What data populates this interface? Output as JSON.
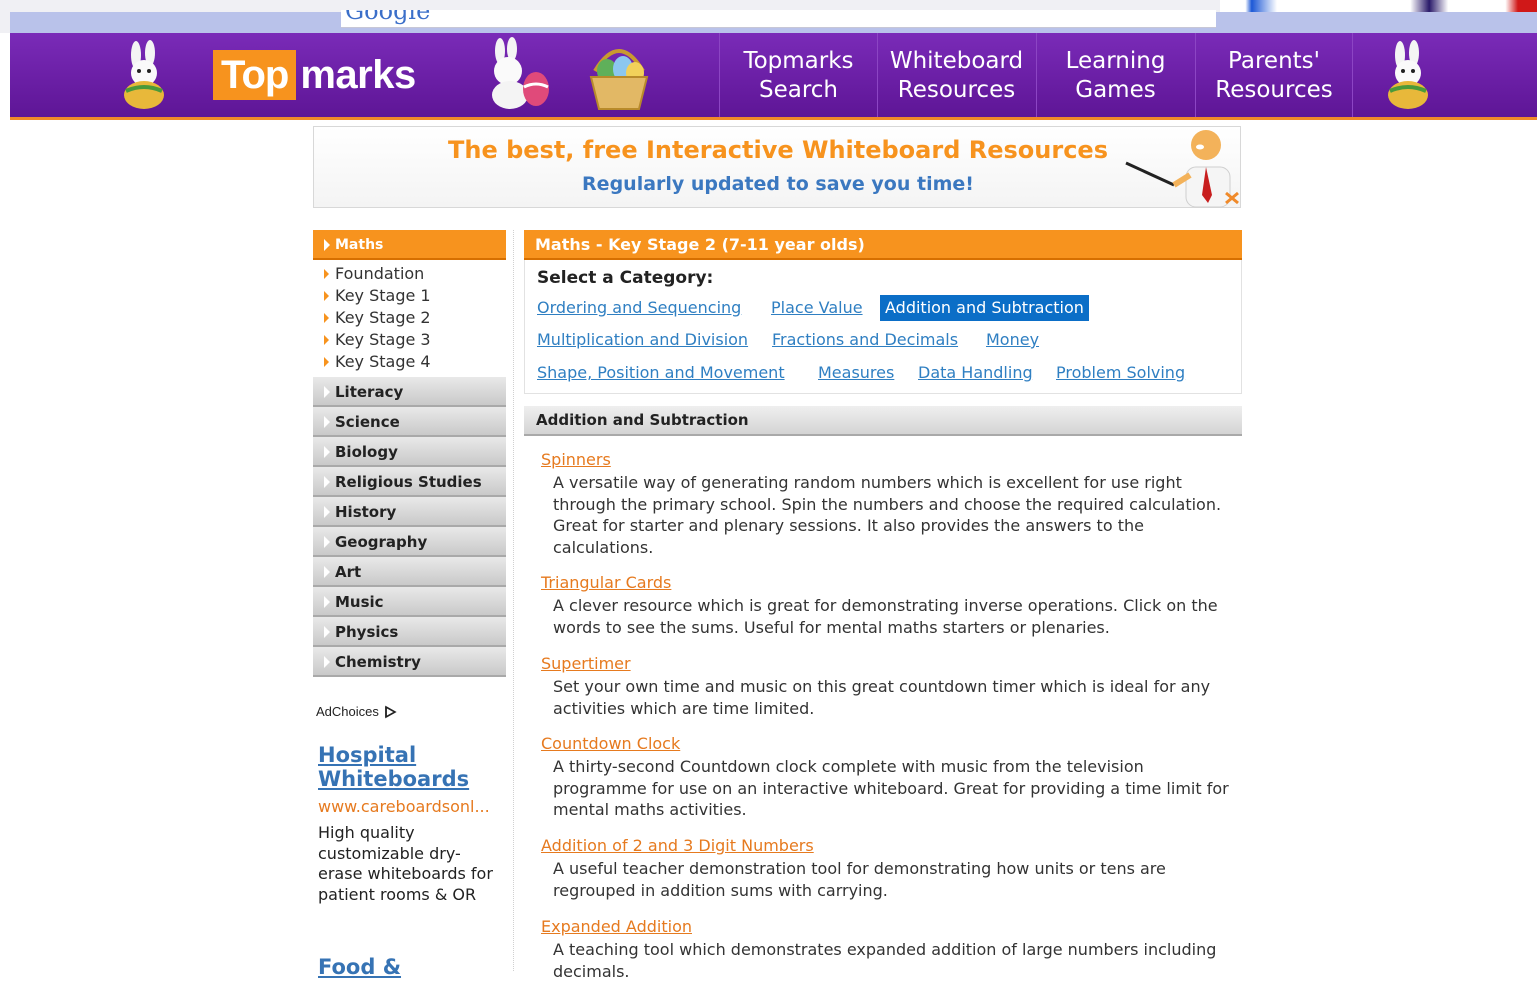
{
  "topbar": {
    "search_logo": "Google"
  },
  "header": {
    "logo": {
      "top": "Top",
      "marks": "marks"
    },
    "nav": [
      {
        "label": "Topmarks\nSearch"
      },
      {
        "label": "Whiteboard\nResources"
      },
      {
        "label": "Learning\nGames"
      },
      {
        "label": "Parents'\nResources"
      }
    ]
  },
  "banner": {
    "headline": "The best, free Interactive Whiteboard Resources",
    "subline": "Regularly updated to save you time!"
  },
  "sidebar": {
    "active": "Maths",
    "sub_items": [
      "Foundation",
      "Key Stage 1",
      "Key Stage 2",
      "Key Stage 3",
      "Key Stage 4"
    ],
    "categories": [
      "Literacy",
      "Science",
      "Biology",
      "Religious Studies",
      "History",
      "Geography",
      "Art",
      "Music",
      "Physics",
      "Chemistry"
    ]
  },
  "ad": {
    "choices_label": "AdChoices",
    "title": "Hospital Whiteboards",
    "url": "www.careboardsonl...",
    "text": "High quality customizable dry-erase whiteboards for patient rooms & OR",
    "next_title": "Food &"
  },
  "main": {
    "heading": "Maths - Key Stage 2 (7-11 year olds)",
    "select_label": "Select a Category:",
    "categories": [
      "Ordering and Sequencing",
      "Place Value",
      "Addition and Subtraction",
      "Multiplication and Division",
      "Fractions and Decimals",
      "Money",
      "Shape, Position and Movement",
      "Measures",
      "Data Handling",
      "Problem Solving"
    ],
    "active_category": "Addition and Subtraction",
    "section_title": "Addition and Subtraction",
    "resources": [
      {
        "title": "Spinners",
        "desc": "A versatile way of generating random numbers which is excellent for use right through the primary school. Spin the numbers and choose the required calculation. Great for starter and plenary sessions. It also provides the answers to the calculations."
      },
      {
        "title": "Triangular Cards",
        "desc": "A clever resource which is great for demonstrating inverse operations. Click on the words to see the sums. Useful for mental maths starters or plenaries."
      },
      {
        "title": "Supertimer",
        "desc": "Set your own time and music on this great countdown timer which is ideal for any activities which are time limited."
      },
      {
        "title": "Countdown Clock",
        "desc": "A thirty-second Countdown clock complete with music from the television programme for use on an interactive whiteboard. Great for providing a time limit for mental maths activities."
      },
      {
        "title": "Addition of 2 and 3 Digit Numbers",
        "desc": "A useful teacher demonstration tool for demonstrating how units or tens are regrouped in addition sums with carrying."
      },
      {
        "title": "Expanded Addition",
        "desc": "A teaching tool which demonstrates expanded addition of large numbers including decimals."
      }
    ]
  }
}
